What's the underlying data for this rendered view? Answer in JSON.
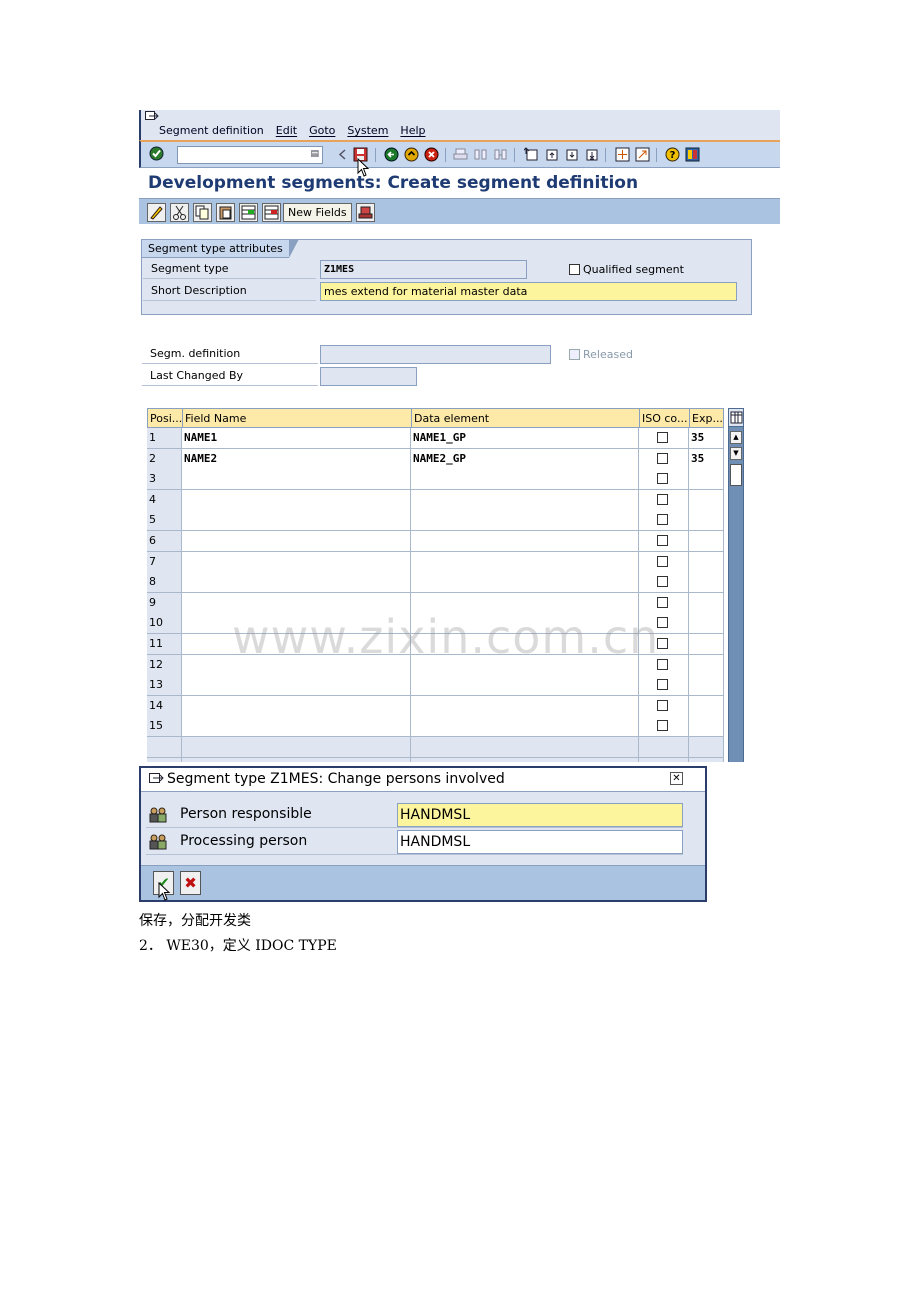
{
  "menubar": {
    "items": [
      "Segment definition",
      "Edit",
      "Goto",
      "System",
      "Help"
    ]
  },
  "window": {
    "title": "Development segments: Create segment definition"
  },
  "app_toolbar": {
    "new_fields_label": "New Fields"
  },
  "attributes": {
    "group_title": "Segment type attributes",
    "segment_type_label": "Segment type",
    "segment_type_value": "Z1MES",
    "qualified_label": "Qualified segment",
    "qualified_checked": false,
    "short_desc_label": "Short Description",
    "short_desc_value": "mes extend for material master data"
  },
  "definition": {
    "segm_def_label": "Segm. definition",
    "segm_def_value": "",
    "released_label": "Released",
    "last_changed_label": "Last Changed By",
    "last_changed_value": ""
  },
  "table": {
    "headers": [
      "Posi...",
      "Field Name",
      "Data element",
      "ISO co...",
      "Exp..."
    ],
    "rows": [
      {
        "pos": "1",
        "field": "NAME1",
        "element": "NAME1_GP",
        "exp": "35"
      },
      {
        "pos": "2",
        "field": "NAME2",
        "element": "NAME2_GP",
        "exp": "35"
      },
      {
        "pos": "3",
        "field": "",
        "element": "",
        "exp": ""
      },
      {
        "pos": "4",
        "field": "",
        "element": "",
        "exp": ""
      },
      {
        "pos": "5",
        "field": "",
        "element": "",
        "exp": ""
      },
      {
        "pos": "6",
        "field": "",
        "element": "",
        "exp": ""
      },
      {
        "pos": "7",
        "field": "",
        "element": "",
        "exp": ""
      },
      {
        "pos": "8",
        "field": "",
        "element": "",
        "exp": ""
      },
      {
        "pos": "9",
        "field": "",
        "element": "",
        "exp": ""
      },
      {
        "pos": "10",
        "field": "",
        "element": "",
        "exp": ""
      },
      {
        "pos": "11",
        "field": "",
        "element": "",
        "exp": ""
      },
      {
        "pos": "12",
        "field": "",
        "element": "",
        "exp": ""
      },
      {
        "pos": "13",
        "field": "",
        "element": "",
        "exp": ""
      },
      {
        "pos": "14",
        "field": "",
        "element": "",
        "exp": ""
      },
      {
        "pos": "15",
        "field": "",
        "element": "",
        "exp": ""
      }
    ]
  },
  "watermark": "www.zixin.com.cn",
  "popup": {
    "title": "Segment type Z1MES: Change persons involved",
    "person_responsible_label": "Person responsible",
    "person_responsible_value": "HANDMSL",
    "processing_person_label": "Processing person",
    "processing_person_value": "HANDMSL"
  },
  "captions": {
    "line1": "保存，分配开发类",
    "line2": "2． WE30，定义 IDOC TYPE"
  },
  "colors": {
    "title_blue": "#1f3b73",
    "toolbar_blue": "#a9c3e0",
    "required_yellow": "#fdf59e",
    "header_yellow": "#fde9a8"
  }
}
